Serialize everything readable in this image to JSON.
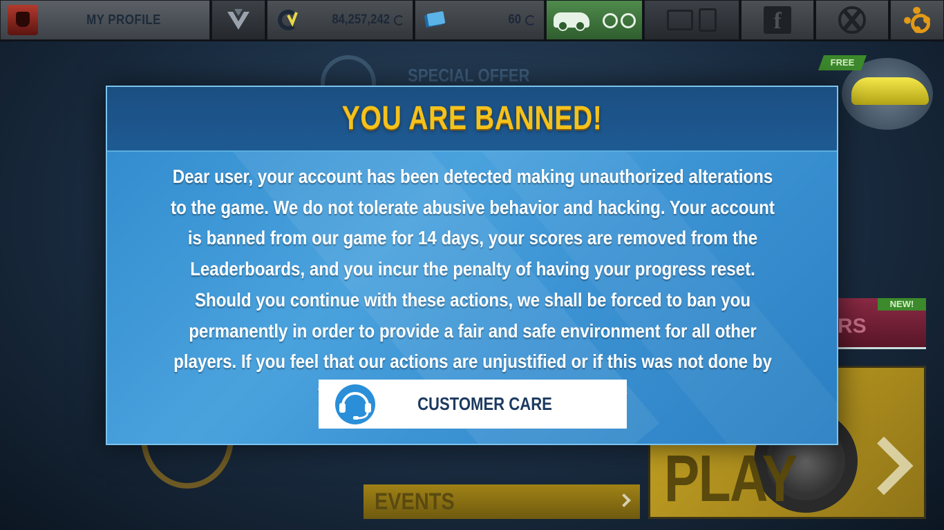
{
  "topbar": {
    "profile_label": "MY PROFILE",
    "credits_value": "84,257,242",
    "tokens_value": "60"
  },
  "background": {
    "special_offer": "SPECIAL OFFER",
    "free_tag": "FREE",
    "new_tag": "NEW!",
    "new_fragment": "RS",
    "play_label": "PLAY",
    "events_label": "EVENTS"
  },
  "modal": {
    "title": "YOU ARE BANNED!",
    "message": "Dear user, your account has been detected making unauthorized alterations to the game. We do not tolerate abusive behavior and hacking. Your account is banned from our game for 14 days, your scores are removed from the Leaderboards, and you incur the penalty of having your progress reset. Should you continue with these actions, we shall be forced to ban you permanently in order to provide a fair and safe environment for all other players. If you feel that our actions are unjustified or if this was not done by you, please contact our Customer Care",
    "button_label": "CUSTOMER CARE"
  },
  "colors": {
    "title": "#f4c21c",
    "modal_bg": "#3d94d4",
    "button_text": "#1c3a60",
    "headset": "#2a8fd8",
    "settings_gear": "#e39a16",
    "garage_green": "#4f8a4c"
  },
  "icons": [
    "avatar-icon",
    "rank-icon",
    "credits-icon",
    "tokens-icon",
    "car-icon",
    "bike-icon",
    "shop-icon",
    "facebook-icon",
    "xbox-icon",
    "gear-icon",
    "headset-icon"
  ]
}
